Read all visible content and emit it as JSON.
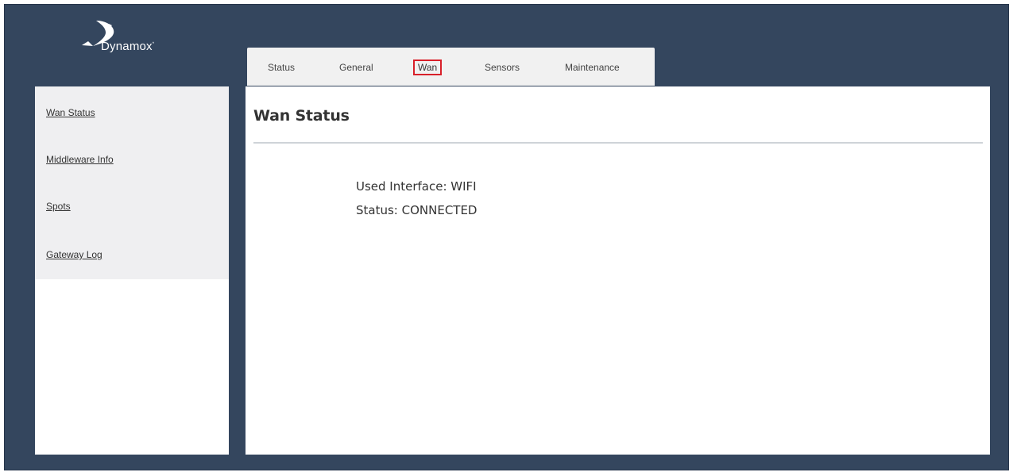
{
  "brand": {
    "name": "Dynamox",
    "trademark": "*"
  },
  "tabs": [
    {
      "label": "Status"
    },
    {
      "label": "General"
    },
    {
      "label": "Wan",
      "active": true
    },
    {
      "label": "Sensors"
    },
    {
      "label": "Maintenance"
    }
  ],
  "sidebar": {
    "items": [
      {
        "label": "Wan Status"
      },
      {
        "label": "Middleware Info"
      },
      {
        "label": "Spots"
      },
      {
        "label": "Gateway Log"
      }
    ]
  },
  "main": {
    "title": "Wan Status",
    "used_interface": "Used Interface: WIFI",
    "status": "Status: CONNECTED"
  },
  "colors": {
    "frame": "#34465e",
    "highlight": "#d8202a",
    "menu_bg": "#efeff1",
    "tab_bg": "#f1f1f1"
  }
}
